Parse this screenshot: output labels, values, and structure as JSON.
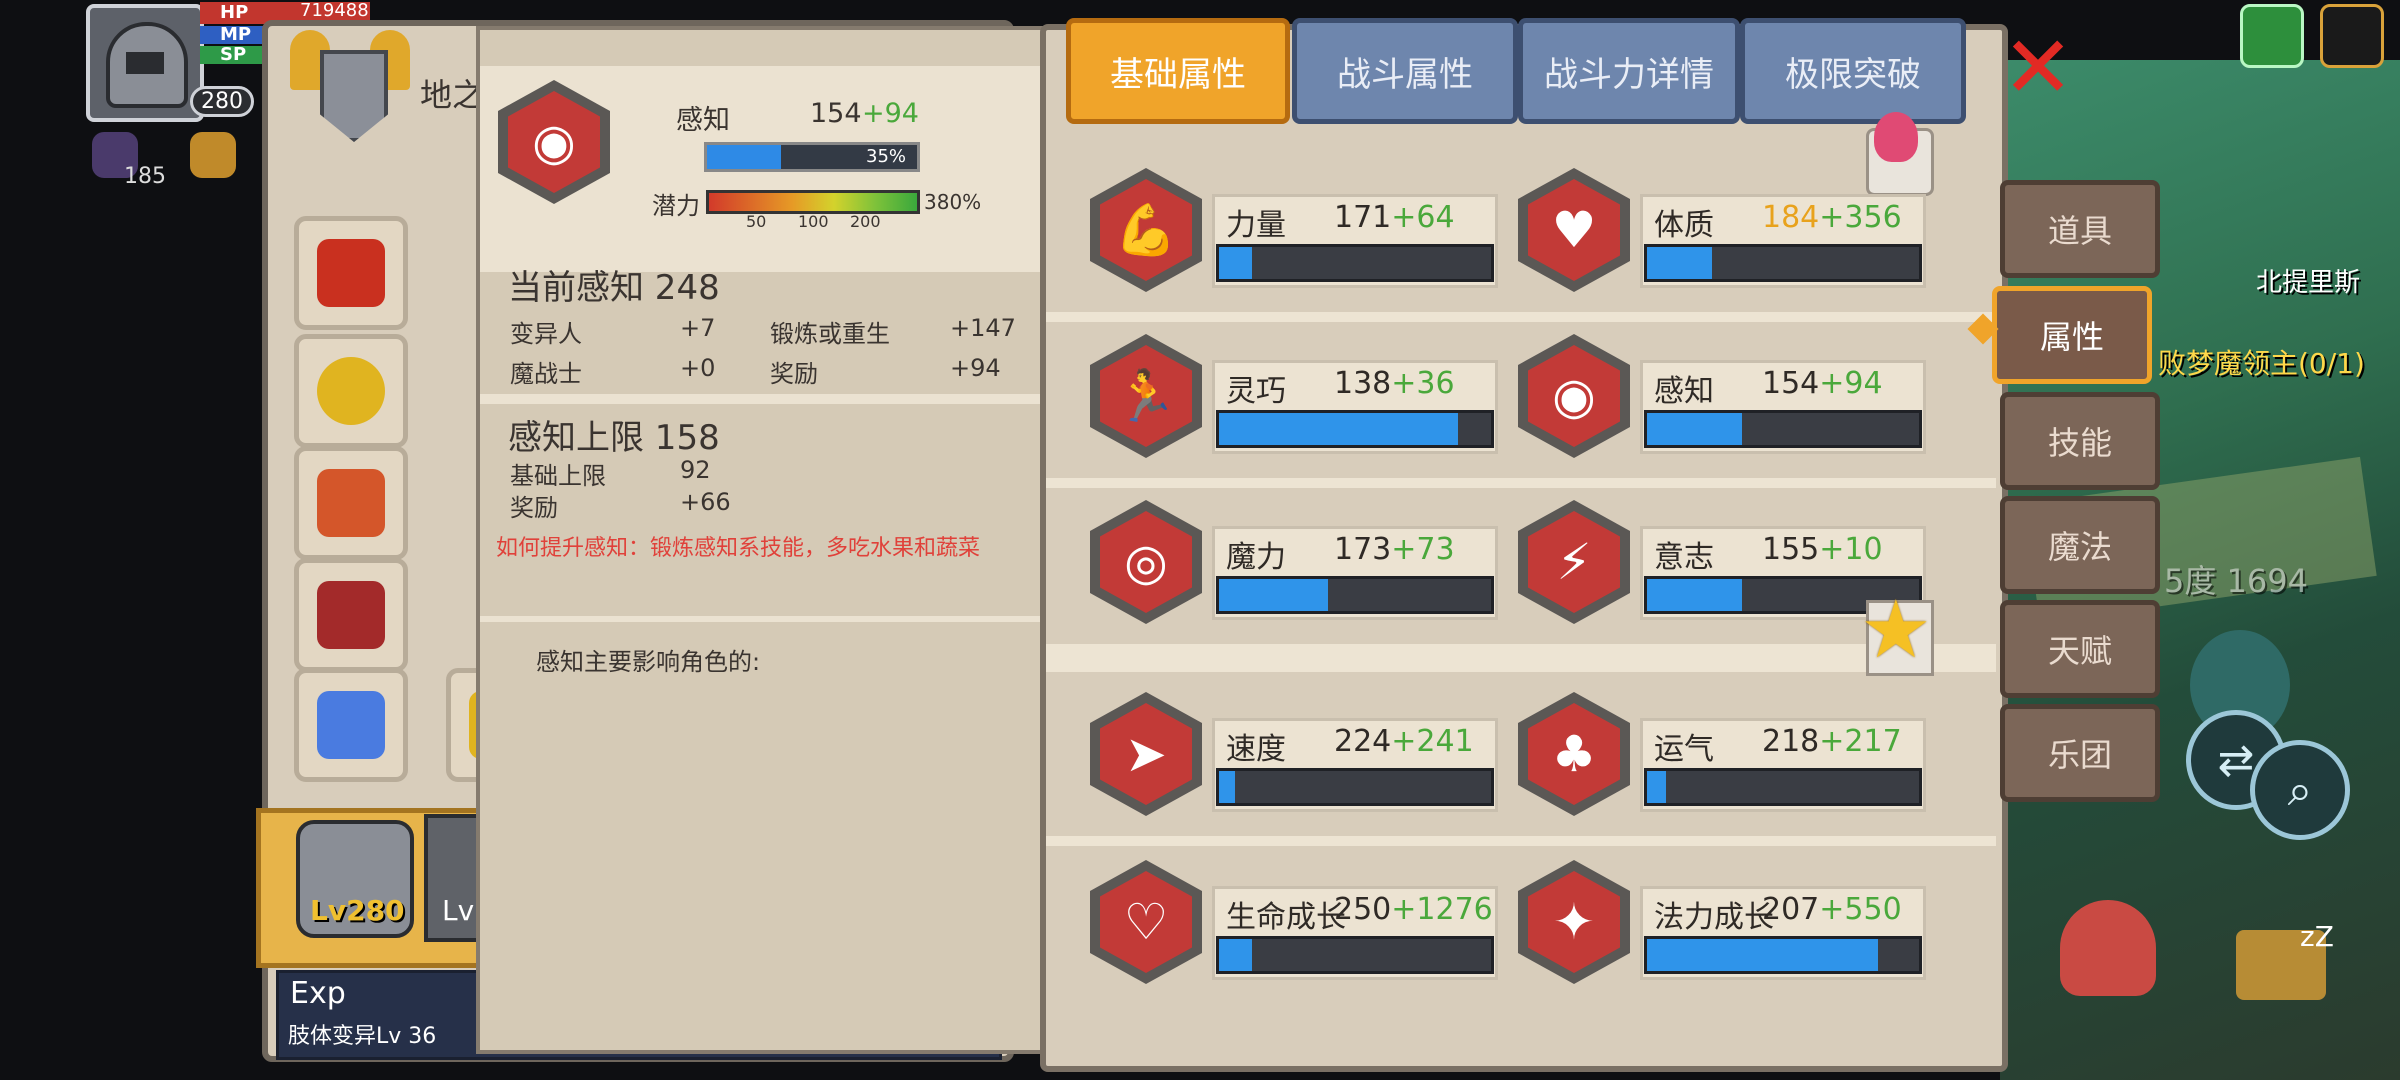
{
  "hud": {
    "hp_label": "HP",
    "mp_label": "MP",
    "sp_label": "SP",
    "hp_value": "719488",
    "level": "280",
    "badge_count": "185"
  },
  "character": {
    "title": "地之",
    "card_level": "Lv280",
    "card2_level": "Lv",
    "exp_label": "Exp",
    "mutation": "肢体变异Lv 36"
  },
  "detail": {
    "stat_name": "感知",
    "base": "154",
    "bonus": "+94",
    "percent_text": "35%",
    "percent": 0.35,
    "potential_label": "潜力",
    "potential_ticks": [
      "50",
      "100",
      "200"
    ],
    "potential_text": "380%",
    "current_title": "当前感知 248",
    "current_rows": [
      {
        "label": "变异人",
        "value": "+7",
        "label2": "锻炼或重生",
        "value2": "+147"
      },
      {
        "label": "魔战士",
        "value": "+0",
        "label2": "奖励",
        "value2": "+94"
      }
    ],
    "cap_title": "感知上限 158",
    "cap_rows": [
      {
        "label": "基础上限",
        "value": "92"
      },
      {
        "label": "奖励",
        "value": "+66"
      }
    ],
    "tip": "如何提升感知：锻炼感知系技能，多吃水果和蔬菜",
    "influence": "感知主要影响角色的:"
  },
  "tabs": [
    "基础属性",
    "战斗属性",
    "战斗力详情",
    "极限突破"
  ],
  "stats": [
    {
      "name": "力量",
      "base": "171",
      "bonus": "+64",
      "fill": 0.12,
      "icon": "strength-icon",
      "glyph": "💪"
    },
    {
      "name": "体质",
      "base": "184",
      "bonus": "+356",
      "fill": 0.24,
      "icon": "constitution-icon",
      "glyph": "♥",
      "orange": true
    },
    {
      "name": "灵巧",
      "base": "138",
      "bonus": "+36",
      "fill": 0.88,
      "icon": "agility-icon",
      "glyph": "🏃"
    },
    {
      "name": "感知",
      "base": "154",
      "bonus": "+94",
      "fill": 0.35,
      "icon": "perception-icon",
      "glyph": "◉"
    },
    {
      "name": "魔力",
      "base": "173",
      "bonus": "+73",
      "fill": 0.4,
      "icon": "magic-power-icon",
      "glyph": "◎"
    },
    {
      "name": "意志",
      "base": "155",
      "bonus": "+10",
      "fill": 0.35,
      "icon": "will-icon",
      "glyph": "⚡"
    },
    {
      "name": "速度",
      "base": "224",
      "bonus": "+241",
      "fill": 0.06,
      "icon": "speed-icon",
      "glyph": "➤"
    },
    {
      "name": "运气",
      "base": "218",
      "bonus": "+217",
      "fill": 0.07,
      "icon": "luck-icon",
      "glyph": "♣"
    },
    {
      "name": "生命成长",
      "base": "250",
      "bonus": "+1276",
      "fill": 0.12,
      "icon": "hp-growth-icon",
      "glyph": "♡"
    },
    {
      "name": "法力成长",
      "base": "207",
      "bonus": "+550",
      "fill": 0.85,
      "icon": "mp-growth-icon",
      "glyph": "✦"
    }
  ],
  "side_menu": [
    "道具",
    "属性",
    "技能",
    "魔法",
    "天赋",
    "乐团"
  ],
  "map": {
    "location": "北提里斯",
    "quest": "败梦魔领主(0/1)",
    "power": "5度 1694"
  }
}
